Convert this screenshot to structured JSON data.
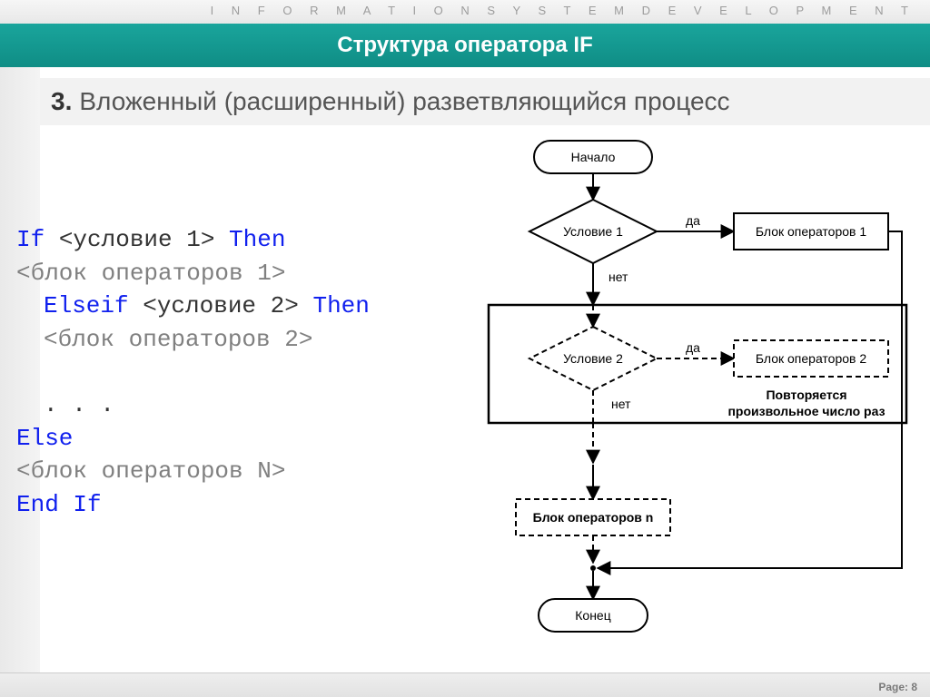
{
  "header": {
    "kicker": "I N F O R M A T I O N   S Y S T E M   D E V E L O P M E N T",
    "title": "Структура оператора IF"
  },
  "subtitle": {
    "num": "3.",
    "text": "Вложенный (расширенный) разветвляющийся процесс"
  },
  "code": {
    "kw_if": "If ",
    "cond1": "<условие 1>",
    "kw_then": " Then",
    "block1": "<блок операторов 1>",
    "kw_elseif": "Elseif ",
    "cond2": "<условие 2>",
    "kw_then2": " Then",
    "block2": "<блок операторов 2>",
    "dots": ". . .",
    "kw_else": "Else",
    "blockN": "<блок операторов N>",
    "kw_endif": "End If"
  },
  "flowchart": {
    "start": "Начало",
    "cond1": "Условие 1",
    "yes": "да",
    "no": "нет",
    "block1": "Блок операторов 1",
    "cond2": "Условие 2",
    "block2": "Блок операторов 2",
    "repeat1": "Повторяется",
    "repeat2": "произвольное число раз",
    "blockN": "Блок операторов n",
    "end": "Конец"
  },
  "footer": {
    "page": "Page: 8"
  }
}
